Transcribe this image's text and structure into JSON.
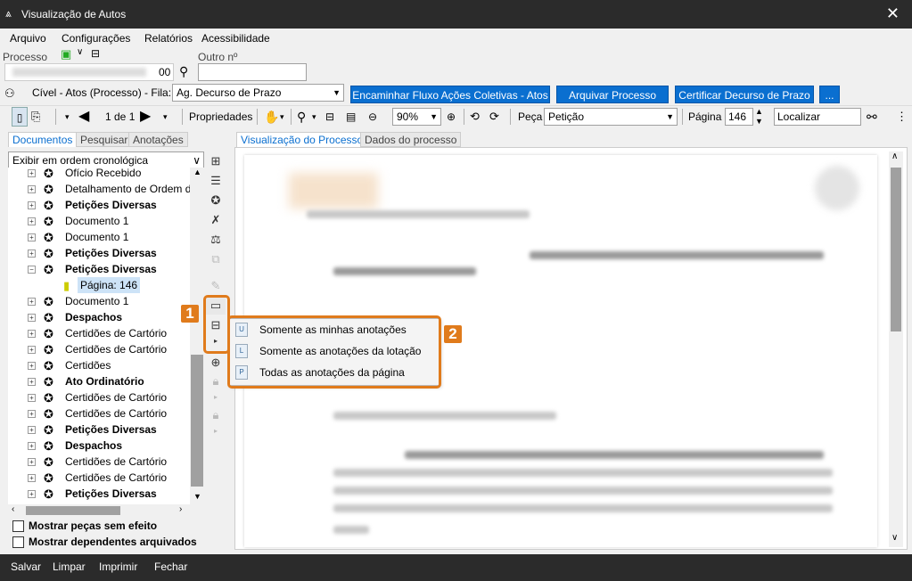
{
  "window": {
    "title": "Visualização de Autos",
    "close": "✕"
  },
  "menu": [
    "Arquivo",
    "Configurações",
    "Relatórios",
    "Acessibilidade"
  ],
  "processo": {
    "label": "Processo",
    "value": "00",
    "outro_label": "Outro nº",
    "outro_value": ""
  },
  "fila": {
    "text": "Cível - Atos (Processo) - Fila:",
    "selected": "Ag. Decurso de Prazo"
  },
  "actions": [
    "Encaminhar Fluxo Ações Coletivas - Atos",
    "Arquivar Processo",
    "Certificar Decurso de Prazo",
    "..."
  ],
  "toolbar": {
    "pages": "1 de 1",
    "properties": "Propriedades",
    "zoom": "90%",
    "peca_label": "Peça",
    "peca_value": "Petição",
    "pagina_label": "Página",
    "pagina_value": "146",
    "localizar": "Localizar"
  },
  "left_tabs": [
    "Documentos",
    "Pesquisar",
    "Anotações"
  ],
  "order_select": "Exibir em ordem cronológica",
  "tree": [
    {
      "label": "Ofício Recebido",
      "bold": false
    },
    {
      "label": "Detalhamento de Ordem de",
      "bold": false
    },
    {
      "label": "Petições Diversas",
      "bold": true
    },
    {
      "label": "Documento 1",
      "bold": false
    },
    {
      "label": "Documento 1",
      "bold": false
    },
    {
      "label": "Petições Diversas",
      "bold": true
    },
    {
      "label": "Petições Diversas",
      "bold": true
    },
    {
      "label": "Página: 146",
      "bold": false,
      "child": true
    },
    {
      "label": "Documento 1",
      "bold": false
    },
    {
      "label": "Despachos",
      "bold": true
    },
    {
      "label": "Certidões de Cartório",
      "bold": false
    },
    {
      "label": "Certidões de Cartório",
      "bold": false
    },
    {
      "label": "Certidões",
      "bold": false
    },
    {
      "label": "Ato Ordinatório",
      "bold": true
    },
    {
      "label": "Certidões de Cartório",
      "bold": false
    },
    {
      "label": "Certidões de Cartório",
      "bold": false
    },
    {
      "label": "Petições Diversas",
      "bold": true
    },
    {
      "label": "Despachos",
      "bold": true
    },
    {
      "label": "Certidões de Cartório",
      "bold": false
    },
    {
      "label": "Certidões de Cartório",
      "bold": false
    },
    {
      "label": "Petições Diversas",
      "bold": true
    }
  ],
  "checkboxes": [
    "Mostrar peças sem efeito",
    "Mostrar dependentes arquivados"
  ],
  "viewer_tabs": [
    "Visualização do Processo",
    "Dados do processo"
  ],
  "popup_menu": [
    "Somente as minhas anotações",
    "Somente as anotações da lotação",
    "Todas as anotações da página"
  ],
  "callouts": [
    "1",
    "2"
  ],
  "bottom": [
    "Salvar",
    "Limpar",
    "Imprimir",
    "Fechar"
  ],
  "colors": {
    "accent": "#0a6fd0",
    "callout": "#e07b1c",
    "titlebar": "#2b2b2b"
  }
}
